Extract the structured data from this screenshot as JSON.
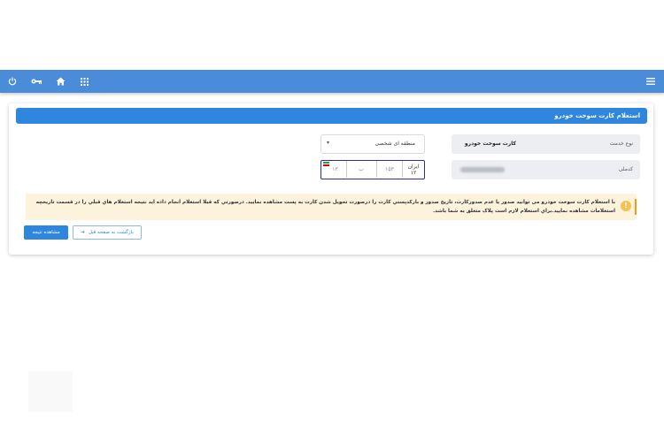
{
  "topbar": {
    "icons": [
      "power-icon",
      "key-icon",
      "home-icon",
      "apps-grid-icon",
      "hamburger-menu-icon"
    ],
    "color": "#4a8cd9"
  },
  "card": {
    "title": "استعلام کارت سوخت خودرو",
    "header_color": "#2e86de"
  },
  "form": {
    "service_type_label": "نوع خدمت",
    "service_type_value": "کارت سوخت خودرو",
    "national_code_label": "کدملی",
    "region_select": "منطقه ای شخصی",
    "plate": {
      "iran_label": "ایران",
      "region_code": "۱۲",
      "three_digits": "۱۵۳",
      "letter": "ب",
      "two_digits": "۱۳"
    }
  },
  "alert": {
    "message": "با استعلام کارت سوخت خودرو می توانید صدور یا عدم صدورکارت، تاریخ صدور و بارکدپستي کارت را درصورت تحويل شدن کارت به پست مشاهده نماييد. درصورتي که قبلا استعلام انجام داده ايد نتيجه استعلام هاي قبلي را در قسمت تاريخچه استعلامات مشاهده نماييد.براي استعلام لازم است پلاک متعلق به شما باشد.",
    "icon": "!",
    "accent": "#f39c12"
  },
  "buttons": {
    "view_result": "مشاهده نتیجه",
    "back": "بازگشت به صفحه قبل"
  }
}
